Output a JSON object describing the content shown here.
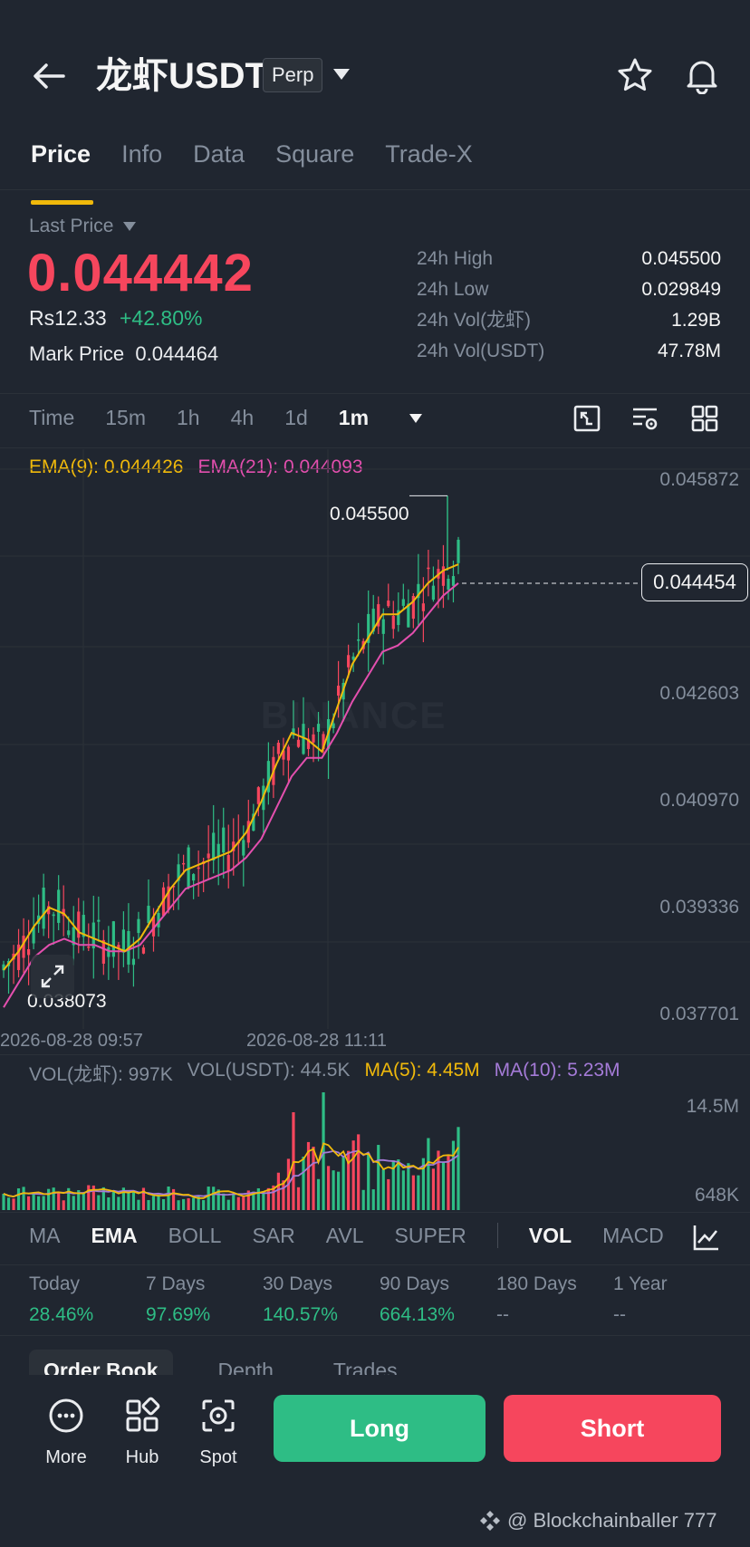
{
  "header": {
    "title": "龙虾USDT",
    "badge": "Perp"
  },
  "tabs": [
    "Price",
    "Info",
    "Data",
    "Square",
    "Trade-X"
  ],
  "price": {
    "last_price_label": "Last Price",
    "last_price": "0.044442",
    "local_price": "Rs12.33",
    "change_pct": "+42.80%",
    "mark_label": "Mark Price",
    "mark_value": "0.044464"
  },
  "stats": [
    {
      "label": "24h High",
      "value": "0.045500"
    },
    {
      "label": "24h Low",
      "value": "0.029849"
    },
    {
      "label": "24h Vol(龙虾)",
      "value": "1.29B"
    },
    {
      "label": "24h Vol(USDT)",
      "value": "47.78M"
    }
  ],
  "intervals": [
    "Time",
    "15m",
    "1h",
    "4h",
    "1d"
  ],
  "interval_active": "1m",
  "ema_legend": {
    "ema9": "EMA(9): 0.044426",
    "ema21": "EMA(21): 0.044093"
  },
  "colors": {
    "up": "#2ebd85",
    "down": "#f6465d",
    "ema9": "#f0b90b",
    "ema21": "#e34fae",
    "ma10": "#a57bd8"
  },
  "chart_data": {
    "type": "candlestick",
    "y_axis_ticks": [
      "0.045872",
      "0.042603",
      "0.040970",
      "0.039336",
      "0.037701"
    ],
    "ylim": [
      0.0371,
      0.0461
    ],
    "x_labels": [
      "2026-08-28 09:57",
      "2026-08-28 11:11"
    ],
    "high_marker": "0.045500",
    "low_marker": "0.038073",
    "current_price_tag": "0.044454",
    "ema9_path": [
      0.0379,
      0.0382,
      0.0386,
      0.0389,
      0.0388,
      0.0385,
      0.0384,
      0.0383,
      0.0382,
      0.0384,
      0.0388,
      0.0392,
      0.0395,
      0.0396,
      0.0397,
      0.0398,
      0.0401,
      0.0406,
      0.0412,
      0.0417,
      0.0416,
      0.0414,
      0.0421,
      0.0428,
      0.0432,
      0.0436,
      0.0436,
      0.0438,
      0.0441,
      0.0443,
      0.0444
    ],
    "ema21_path": [
      0.0373,
      0.0377,
      0.0381,
      0.0383,
      0.0384,
      0.0383,
      0.0383,
      0.0382,
      0.0382,
      0.0383,
      0.0386,
      0.0389,
      0.0392,
      0.0393,
      0.0394,
      0.0395,
      0.0397,
      0.04,
      0.0405,
      0.041,
      0.0413,
      0.0413,
      0.0417,
      0.0422,
      0.0426,
      0.043,
      0.0431,
      0.0433,
      0.0436,
      0.0439,
      0.0441
    ]
  },
  "volume": {
    "vol_base": "VOL(龙虾): 997K",
    "vol_usdt": "VOL(USDT): 44.5K",
    "ma5": "MA(5): 4.45M",
    "ma10": "MA(10): 5.23M",
    "axis_top": "14.5M",
    "axis_bottom": "648K"
  },
  "indicator_tabs": [
    "MA",
    "EMA",
    "BOLL",
    "SAR",
    "AVL",
    "SUPER"
  ],
  "indicator_active": "EMA",
  "indicator_sub": [
    "VOL",
    "MACD"
  ],
  "performance": [
    {
      "label": "Today",
      "value": "28.46%"
    },
    {
      "label": "7 Days",
      "value": "97.69%"
    },
    {
      "label": "30 Days",
      "value": "140.57%"
    },
    {
      "label": "90 Days",
      "value": "664.13%"
    },
    {
      "label": "180 Days",
      "value": "--"
    },
    {
      "label": "1 Year",
      "value": "--"
    }
  ],
  "section_tabs": [
    "Order Book",
    "Depth",
    "Trades"
  ],
  "bottom_nav": [
    "More",
    "Hub",
    "Spot"
  ],
  "actions": {
    "long": "Long",
    "short": "Short"
  },
  "watermark": "BINANCE",
  "credit": "@ Blockchainballer 777"
}
